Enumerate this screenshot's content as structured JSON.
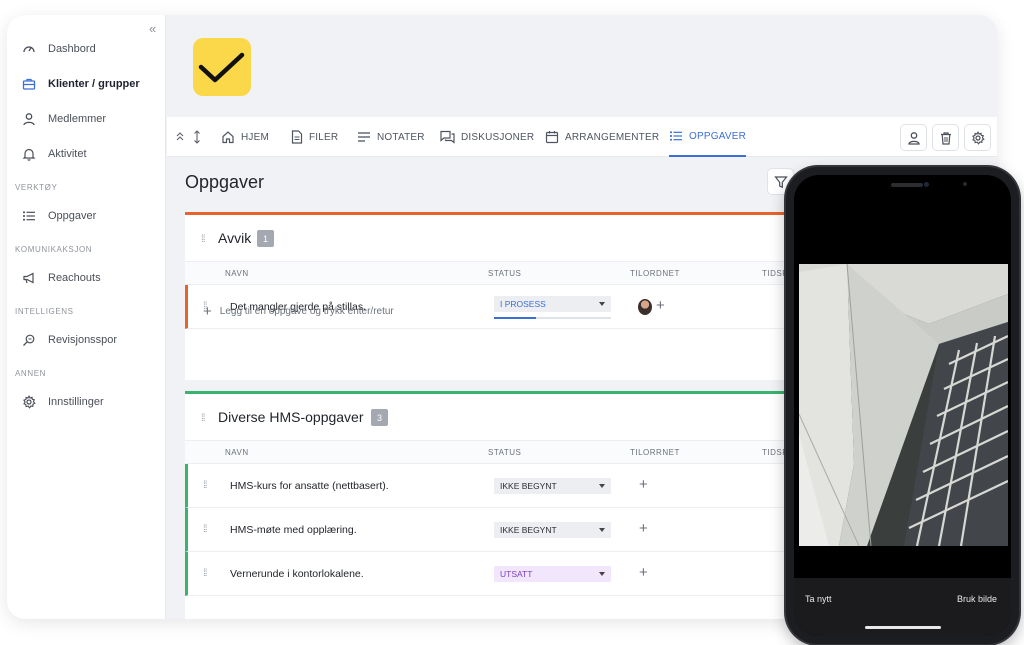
{
  "sidebar": {
    "items": [
      {
        "label": "Dashbord",
        "icon": "speedometer-icon"
      },
      {
        "label": "Klienter / grupper",
        "icon": "briefcase-icon"
      },
      {
        "label": "Medlemmer",
        "icon": "person-icon"
      },
      {
        "label": "Aktivitet",
        "icon": "bell-icon"
      }
    ],
    "sections": [
      {
        "label": "VERKTØY",
        "items": [
          {
            "label": "Oppgaver",
            "icon": "list-icon"
          }
        ]
      },
      {
        "label": "KOMUNIKAKSJON",
        "items": [
          {
            "label": "Reachouts",
            "icon": "megaphone-icon"
          }
        ]
      },
      {
        "label": "INTELLIGENS",
        "items": [
          {
            "label": "Revisjonsspor",
            "icon": "search-zoom-icon"
          }
        ]
      },
      {
        "label": "ANNEN",
        "items": [
          {
            "label": "Innstillinger",
            "icon": "gear-icon"
          }
        ]
      }
    ],
    "collapse": "«"
  },
  "tabs": [
    {
      "label": "HJEM",
      "icon": "home-icon"
    },
    {
      "label": "FILER",
      "icon": "file-icon"
    },
    {
      "label": "NOTATER",
      "icon": "notes-icon"
    },
    {
      "label": "DISKUSJONER",
      "icon": "chat-icon"
    },
    {
      "label": "ARRANGEMENTER",
      "icon": "calendar-icon"
    },
    {
      "label": "OPPGAVER",
      "icon": "list-icon",
      "active": true
    }
  ],
  "page": {
    "title": "Oppgaver"
  },
  "columns": {
    "name": "NAVN",
    "status": "STATUS",
    "assignee1": "TILORDNET",
    "assignee2": "TILORRNET",
    "due": "TIDSF"
  },
  "groups": [
    {
      "title": "Avvik",
      "count": "1",
      "accent": "#e8632b",
      "rows": [
        {
          "name": "Det mangler gjerde på stillas.",
          "status": "I PROSESS",
          "progress": 0.36
        }
      ],
      "add_task": "Legg til en oppgave og trykk enter/retur"
    },
    {
      "title": "Diverse HMS-oppgaver",
      "count": "3",
      "accent": "#3bb26e",
      "rows": [
        {
          "name": "HMS-kurs for ansatte (nettbasert).",
          "status": "IKKE BEGYNT"
        },
        {
          "name": "HMS-møte med opplæring.",
          "status": "IKKE BEGYNT"
        },
        {
          "name": "Vernerunde i kontorlokalene.",
          "status": "UTSATT"
        }
      ]
    }
  ],
  "phone": {
    "retake": "Ta nytt",
    "use_photo": "Bruk bilde"
  },
  "colors": {
    "brand_yellow": "#fad84a",
    "accent_blue": "#3a6fd8",
    "status_bg": "#eceef1",
    "utsatt_bg": "#f1e6fb"
  }
}
